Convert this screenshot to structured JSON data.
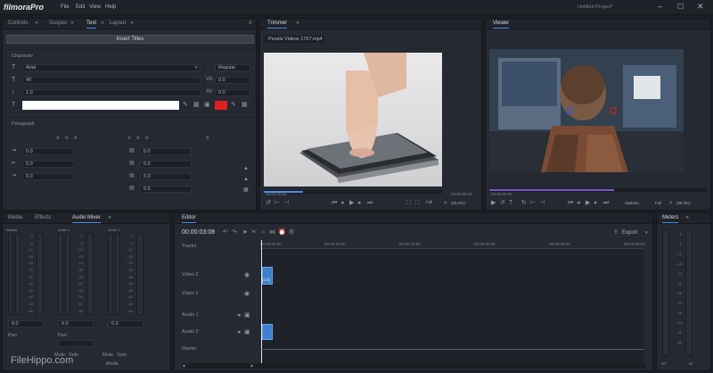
{
  "menubar": {
    "app_name": "filmoraPro",
    "items": [
      "File",
      "Edit",
      "View",
      "Help"
    ],
    "project_title": "Untitled Project*"
  },
  "controls": {
    "tabs": [
      {
        "label": "Controls"
      },
      {
        "label": "Scopes"
      },
      {
        "label": "Text"
      },
      {
        "label": "Layout"
      }
    ],
    "insert_title": "Insert Titles",
    "character_label": "Character",
    "font": "Arial",
    "font_style": "Regular",
    "font_size": "40",
    "tracking": "0.0",
    "leading": "1.0",
    "kerning": "0.0",
    "stroke_color": "#e02020",
    "paragraph_label": "Paragraph",
    "paragraph_values": [
      "0.0",
      "0.0",
      "0.0",
      "0.0",
      "0.0",
      "0.0",
      "0.0"
    ]
  },
  "trimmer": {
    "tab": "Trimmer",
    "clip_name": "Pexels Videos 1767.mp4",
    "timecode": "00:00:00:01",
    "end_timecode": "00:00:09:19",
    "zoom": "Full",
    "zoom_pct": "(26.4%)"
  },
  "viewer": {
    "tab": "Viewer",
    "timecode": "00:00:00:00",
    "options": "Options",
    "zoom": "Full",
    "zoom_pct": "(26.3%)"
  },
  "media": {
    "tabs": [
      {
        "label": "Media"
      },
      {
        "label": "Effects"
      },
      {
        "label": "Audio Mixer"
      }
    ],
    "channels": [
      "Master",
      "Audio 1",
      "Audio 2"
    ],
    "scale": [
      "0",
      "-6",
      "-12",
      "-18",
      "-24",
      "-30",
      "-36",
      "-42",
      "-48",
      "-54",
      "-60",
      "-66"
    ],
    "bottom_values": [
      "0.0",
      "0.0",
      "0.0"
    ],
    "left_labels": [
      "Pan",
      "Pan"
    ],
    "buttons": [
      "Mute",
      "Solo",
      "Mute",
      "Solo"
    ],
    "mode": "Mode"
  },
  "editor": {
    "tab": "Editor",
    "timecode": "00:00:03:08",
    "export": "Export",
    "tracks_label": "Tracks",
    "ruler": [
      "00:00:00:00",
      "00:00:10:00",
      "00:00:20:00",
      "00:00:30:00",
      "00:00:40:00",
      "00:00:50:00"
    ],
    "tracks": [
      {
        "name": "Video 2"
      },
      {
        "name": "Video 1"
      },
      {
        "name": "Audio 1"
      },
      {
        "name": "Audio 2"
      },
      {
        "name": "Master"
      }
    ],
    "clip_label": "[1.0]"
  },
  "meters": {
    "tab": "Meters",
    "bottom": [
      "-Inf",
      "-Inf"
    ]
  },
  "watermark": "FileHippo.com"
}
